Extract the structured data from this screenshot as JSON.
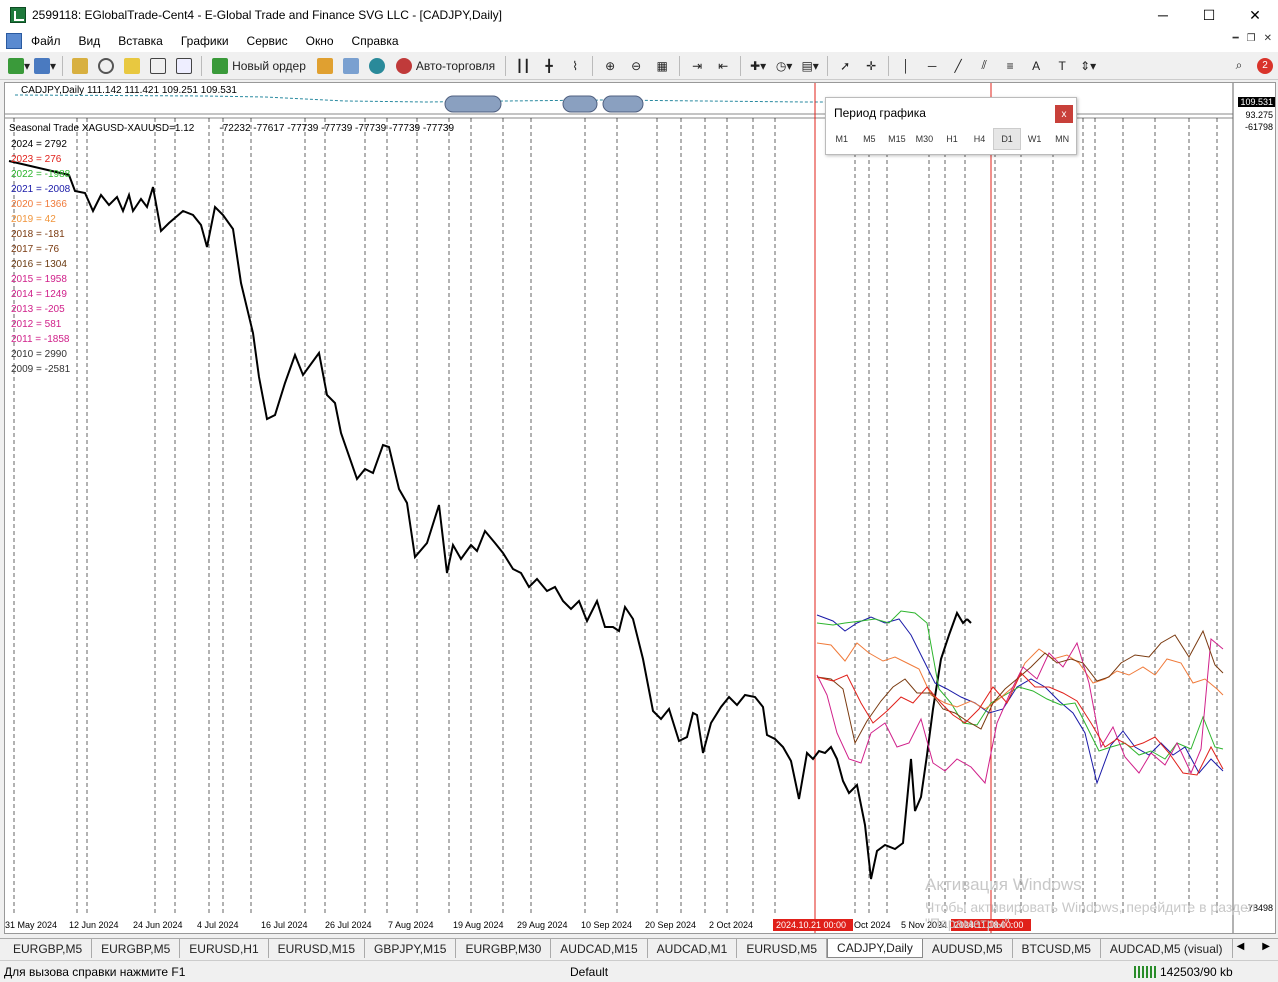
{
  "window": {
    "title": "2599118: EGlobalTrade-Cent4 - E-Global Trade and Finance SVG LLC - [CADJPY,Daily]",
    "minimize": "─",
    "maximize": "☐",
    "close": "✕"
  },
  "menu": {
    "items": [
      "Файл",
      "Вид",
      "Вставка",
      "Графики",
      "Сервис",
      "Окно",
      "Справка"
    ]
  },
  "toolbar": {
    "new_order": "Новый ордер",
    "auto_trading": "Авто-торговля",
    "notifications": "2"
  },
  "chart": {
    "symbol_line": "CADJPY,Daily  111.142 111.421 109.251 109.531",
    "price_marker": "109.531",
    "price_upper": "93.275",
    "price_low_1": "-61798",
    "price_low_2": "-78498",
    "indicator_label": "Seasonal Trade XAGUSD-XAUUSD=1.12",
    "indicator_values": "-72232 -77617 -77739 -77739 -77739 -77739 -77739",
    "date_labels": [
      "31 May 2024",
      "12 Jun 2024",
      "24 Jun 2024",
      "4 Jul 2024",
      "16 Jul 2024",
      "26 Jul 2024",
      "7 Aug 2024",
      "19 Aug 2024",
      "29 Aug 2024",
      "10 Sep 2024",
      "20 Sep 2024",
      "2 Oct 2024",
      "Oct 2024",
      "5 Nov 2024"
    ],
    "marker_1": "2024.10.21 00:00",
    "marker_2": "2024.11.18 00:00"
  },
  "legend": [
    {
      "text": "2024 = 2792",
      "color": "#000000"
    },
    {
      "text": "2023 = 276",
      "color": "#e0201a"
    },
    {
      "text": "2022 = -1988",
      "color": "#2db52d"
    },
    {
      "text": "2021 = -2008",
      "color": "#1a1aa8"
    },
    {
      "text": "2020 = 1366",
      "color": "#f07a3a"
    },
    {
      "text": "2019 = 42",
      "color": "#f0943a"
    },
    {
      "text": "2018 = -181",
      "color": "#7a3a10"
    },
    {
      "text": "2017 = -76",
      "color": "#7a3a10"
    },
    {
      "text": "2016 = 1304",
      "color": "#6a3a10"
    },
    {
      "text": "2015 = 1958",
      "color": "#d0208a"
    },
    {
      "text": "2014 = 1249",
      "color": "#d0208a"
    },
    {
      "text": "2013 = -205",
      "color": "#d0208a"
    },
    {
      "text": "2012 = 581",
      "color": "#d0208a"
    },
    {
      "text": "2011 = -1858",
      "color": "#d0208a"
    },
    {
      "text": "2010 = 2990",
      "color": "#333333"
    },
    {
      "text": "2009 = -2581",
      "color": "#333333"
    }
  ],
  "period_dialog": {
    "title": "Период графика",
    "close": "x",
    "periods": [
      "M1",
      "M5",
      "M15",
      "M30",
      "H1",
      "H4",
      "D1",
      "W1",
      "MN"
    ],
    "selected": "D1"
  },
  "watermark": {
    "line1": "Активация Windows",
    "line2": "Чтобы активировать Windows, перейдите в раздел \"Параметры\"."
  },
  "tabs": [
    "EURGBP,M5",
    "EURGBP,M5",
    "EURUSD,H1",
    "EURUSD,M15",
    "GBPJPY,M15",
    "EURGBP,M30",
    "AUDCAD,M15",
    "AUDCAD,M1",
    "EURUSD,M5",
    "CADJPY,Daily",
    "AUDUSD,M5",
    "BTCUSD,M5",
    "AUDCAD,M5 (visual)"
  ],
  "active_tab": "CADJPY,Daily",
  "status": {
    "help": "Для вызова справки нажмите F1",
    "profile": "Default",
    "traffic": "142503/90 kb"
  }
}
